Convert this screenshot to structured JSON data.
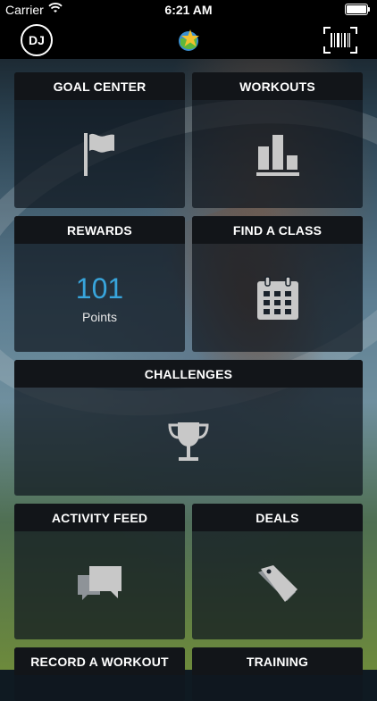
{
  "status_bar": {
    "carrier": "Carrier",
    "time": "6:21 AM"
  },
  "nav": {
    "avatar_initials": "DJ",
    "logo_icon": "brand-star-globe-icon",
    "right_icon": "barcode-scan-icon"
  },
  "tiles": {
    "goal_center": {
      "title": "GOAL CENTER",
      "icon": "flag-icon"
    },
    "workouts": {
      "title": "WORKOUTS",
      "icon": "bar-chart-icon"
    },
    "rewards": {
      "title": "REWARDS",
      "points_value": "101",
      "points_label": "Points"
    },
    "find_a_class": {
      "title": "FIND A CLASS",
      "icon": "calendar-icon"
    },
    "challenges": {
      "title": "CHALLENGES",
      "icon": "trophy-icon"
    },
    "activity_feed": {
      "title": "ACTIVITY FEED",
      "icon": "chat-bubbles-icon"
    },
    "deals": {
      "title": "DEALS",
      "icon": "tags-icon"
    },
    "record_a_workout": {
      "title": "RECORD A WORKOUT"
    },
    "training": {
      "title": "TRAINING"
    }
  },
  "colors": {
    "accent_blue": "#38a5dc",
    "tile_header": "#121519",
    "icon_gray": "#c8c8c8"
  }
}
